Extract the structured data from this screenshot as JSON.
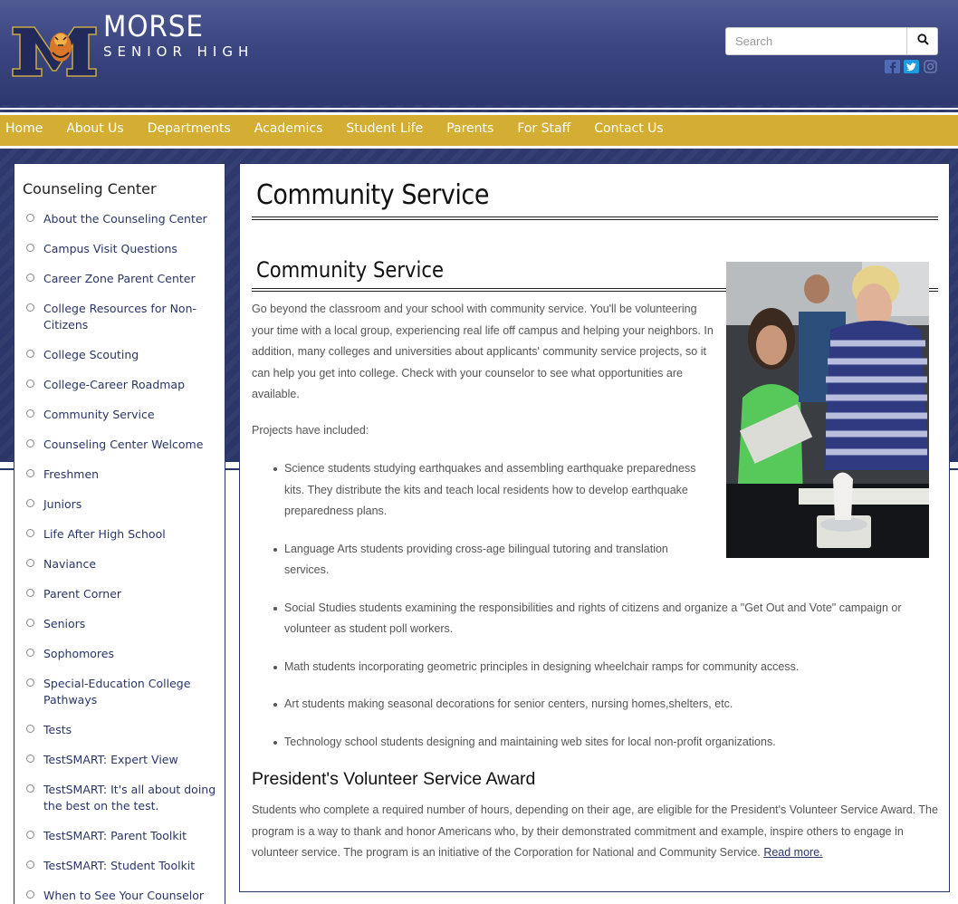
{
  "brand": {
    "title": "MORSE",
    "subtitle": "SENIOR HIGH",
    "logo_icon": "tiger-m-logo-icon"
  },
  "search": {
    "placeholder": "Search",
    "value": "",
    "icon": "search-icon"
  },
  "social": [
    {
      "name": "facebook",
      "glyph": "f",
      "color": "#3b5998"
    },
    {
      "name": "twitter",
      "glyph": "t",
      "color": "#1da1f2"
    },
    {
      "name": "instagram",
      "glyph": "◎",
      "color": "#5a6699"
    }
  ],
  "nav": {
    "items": [
      {
        "label": "Home"
      },
      {
        "label": "About Us"
      },
      {
        "label": "Departments"
      },
      {
        "label": "Academics"
      },
      {
        "label": "Student Life"
      },
      {
        "label": "Parents"
      },
      {
        "label": "For Staff"
      },
      {
        "label": "Contact Us"
      }
    ]
  },
  "sidebar": {
    "heading": "Counseling Center",
    "items": [
      {
        "label": "About the Counseling Center"
      },
      {
        "label": "Campus Visit Questions"
      },
      {
        "label": "Career Zone Parent Center"
      },
      {
        "label": "College Resources for Non-Citizens"
      },
      {
        "label": "College Scouting"
      },
      {
        "label": "College-Career Roadmap"
      },
      {
        "label": "Community Service"
      },
      {
        "label": "Counseling Center Welcome"
      },
      {
        "label": "Freshmen"
      },
      {
        "label": "Juniors"
      },
      {
        "label": "Life After High School"
      },
      {
        "label": "Naviance"
      },
      {
        "label": "Parent Corner"
      },
      {
        "label": "Seniors"
      },
      {
        "label": "Sophomores"
      },
      {
        "label": "Special-Education College Pathways"
      },
      {
        "label": "Tests"
      },
      {
        "label": "TestSMART: Expert View"
      },
      {
        "label": "TestSMART: It's all about doing the best on the test."
      },
      {
        "label": "TestSMART: Parent Toolkit"
      },
      {
        "label": "TestSMART: Student Toolkit"
      },
      {
        "label": "When to See Your Counselor"
      }
    ]
  },
  "main": {
    "page_title": "Community Service",
    "section_title": "Community Service",
    "intro": "Go beyond the classroom and your school with community service. You'll be volunteering your time with a local group, experiencing real life off campus and helping your neighbors. In addition, many colleges and universities about applicants' community service projects, so it can help you get into college. Check with your counselor to see what opportunities are available.",
    "projects_label": "Projects have included:",
    "projects": [
      "Science students studying earthquakes and assembling earthquake preparedness kits. They distribute the kits and teach local residents how to develop earthquake preparedness plans.",
      "Language Arts students providing cross-age bilingual tutoring and translation services.",
      "Social Studies students examining the responsibilities and rights of citizens and organize a \"Get Out and Vote\" campaign or volunteer as student poll workers.",
      "Math students incorporating geometric principles in designing wheelchair ramps for community access.",
      "Art students making seasonal decorations for senior centers, nursing homes,shelters, etc.",
      "Technology school students designing and maintaining web sites for local non-profit organizations."
    ],
    "award_title": "President's Volunteer Service Award",
    "award_text": "Students who complete a required number of hours, depending on their age, are eligible for the President's Volunteer Service Award. The program is a way to thank and honor Americans who, by their demonstrated commitment and example, inspire others to engage in volunteer service. The program is an initiative of the Corporation for National and Community Service.",
    "award_link": "Read more."
  },
  "colors": {
    "navy": "#2a3567",
    "gold": "#d4ae33",
    "header_top": "#4f5a93"
  }
}
